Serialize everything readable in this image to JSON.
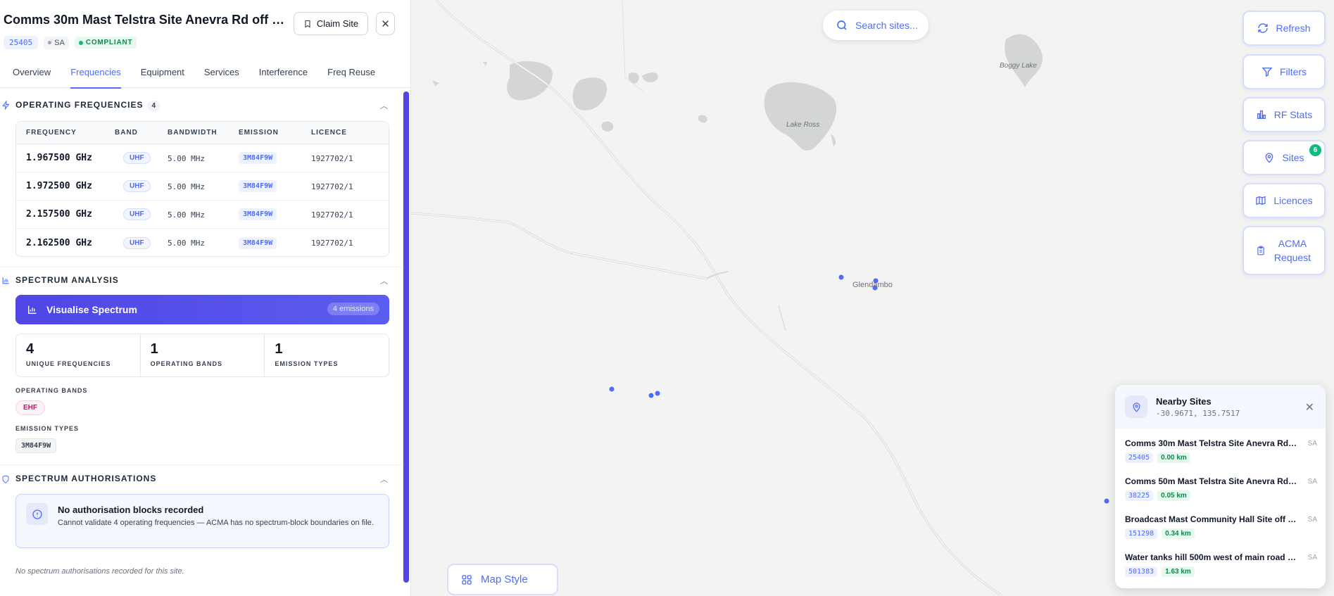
{
  "site": {
    "title": "Comms 30m Mast Telstra Site Anevra Rd off R...",
    "id": "25405",
    "state": "SA",
    "status": "COMPLIANT",
    "claim_label": "Claim Site",
    "close_symbol": "✕"
  },
  "tabs": [
    "Overview",
    "Frequencies",
    "Equipment",
    "Services",
    "Interference",
    "Freq Reuse"
  ],
  "active_tab": "Frequencies",
  "operating_frequencies": {
    "title": "OPERATING FREQUENCIES",
    "count": "4",
    "headers": [
      "FREQUENCY",
      "BAND",
      "BANDWIDTH",
      "EMISSION",
      "LICENCE"
    ],
    "rows": [
      {
        "frequency": "1.967500 GHz",
        "band": "UHF",
        "bandwidth": "5.00 MHz",
        "emission": "3M84F9W",
        "licence": "1927702/1"
      },
      {
        "frequency": "1.972500 GHz",
        "band": "UHF",
        "bandwidth": "5.00 MHz",
        "emission": "3M84F9W",
        "licence": "1927702/1"
      },
      {
        "frequency": "2.157500 GHz",
        "band": "UHF",
        "bandwidth": "5.00 MHz",
        "emission": "3M84F9W",
        "licence": "1927702/1"
      },
      {
        "frequency": "2.162500 GHz",
        "band": "UHF",
        "bandwidth": "5.00 MHz",
        "emission": "3M84F9W",
        "licence": "1927702/1"
      }
    ]
  },
  "spectrum_analysis": {
    "title": "SPECTRUM ANALYSIS",
    "visualise_label": "Visualise Spectrum",
    "visualise_count": "4 emissions",
    "stats": [
      {
        "value": "4",
        "label": "UNIQUE FREQUENCIES"
      },
      {
        "value": "1",
        "label": "OPERATING BANDS"
      },
      {
        "value": "1",
        "label": "EMISSION TYPES"
      }
    ],
    "operating_bands_label": "OPERATING BANDS",
    "operating_band": "EHF",
    "emission_types_label": "EMISSION TYPES",
    "emission_type": "3M84F9W"
  },
  "spectrum_authorisations": {
    "title": "SPECTRUM AUTHORISATIONS",
    "notice_title": "No authorisation blocks recorded",
    "notice_body": "Cannot validate 4 operating frequencies — ACMA has no spectrum-block boundaries on file.",
    "footer": "No spectrum authorisations recorded for this site."
  },
  "map": {
    "search_placeholder": "Search sites...",
    "labels": {
      "lake_ross": "Lake Ross",
      "boggy_lake": "Boggy Lake",
      "town": "Glendambo"
    },
    "controls": [
      {
        "label": "Refresh",
        "icon": "refresh-icon"
      },
      {
        "label": "Filters",
        "icon": "filter-icon"
      },
      {
        "label": "RF Stats",
        "icon": "bar-chart-icon"
      },
      {
        "label": "Sites",
        "icon": "map-pin-icon",
        "badge": "6"
      },
      {
        "label": "Licences",
        "icon": "map-icon"
      },
      {
        "label": "ACMA Request",
        "icon": "clipboard-icon"
      }
    ],
    "map_style_label": "Map Style",
    "accent_color": "#4f6cf7"
  },
  "nearby": {
    "title": "Nearby Sites",
    "coords": "-30.9671, 135.7517",
    "items": [
      {
        "name": "Comms 30m Mast Telstra Site Anevra Rd off ...",
        "state": "SA",
        "id": "25405",
        "distance": "0.00 km"
      },
      {
        "name": "Comms 50m Mast Telstra Site Anevra Rd off ...",
        "state": "SA",
        "id": "38225",
        "distance": "0.05 km"
      },
      {
        "name": "Broadcast Mast Community Hall Site off Rob...",
        "state": "SA",
        "id": "151298",
        "distance": "0.34 km"
      },
      {
        "name": "Water tanks hill 500m west of main road GLE...",
        "state": "SA",
        "id": "501383",
        "distance": "1.63 km"
      }
    ]
  }
}
